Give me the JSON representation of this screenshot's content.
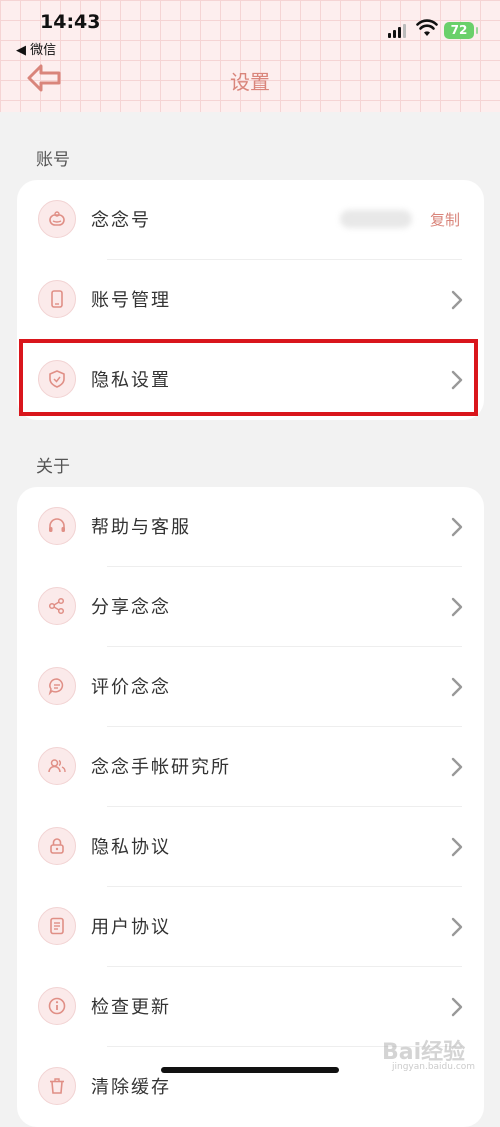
{
  "status_bar": {
    "time": "14:43",
    "back_app": "◀ 微信",
    "battery": "72"
  },
  "header": {
    "title": "设置"
  },
  "sections": {
    "account": {
      "label": "账号",
      "rows": [
        {
          "label": "念念号",
          "icon": "robot-icon",
          "copy_label": "复制"
        },
        {
          "label": "账号管理",
          "icon": "phone-icon"
        },
        {
          "label": "隐私设置",
          "icon": "shield-icon"
        }
      ]
    },
    "about": {
      "label": "关于",
      "rows": [
        {
          "label": "帮助与客服",
          "icon": "headset-icon"
        },
        {
          "label": "分享念念",
          "icon": "share-icon"
        },
        {
          "label": "评价念念",
          "icon": "chat-icon"
        },
        {
          "label": "念念手帐研究所",
          "icon": "users-icon"
        },
        {
          "label": "隐私协议",
          "icon": "lock-icon"
        },
        {
          "label": "用户协议",
          "icon": "document-icon"
        },
        {
          "label": "检查更新",
          "icon": "info-icon"
        },
        {
          "label": "清除缓存",
          "icon": "trash-icon"
        }
      ]
    }
  },
  "colors": {
    "accent": "#d9857b",
    "highlight": "#d9161c",
    "icon_bg": "#fbeaea"
  },
  "watermark": {
    "brand": "Bai经验",
    "url": "jingyan.baidu.com"
  }
}
